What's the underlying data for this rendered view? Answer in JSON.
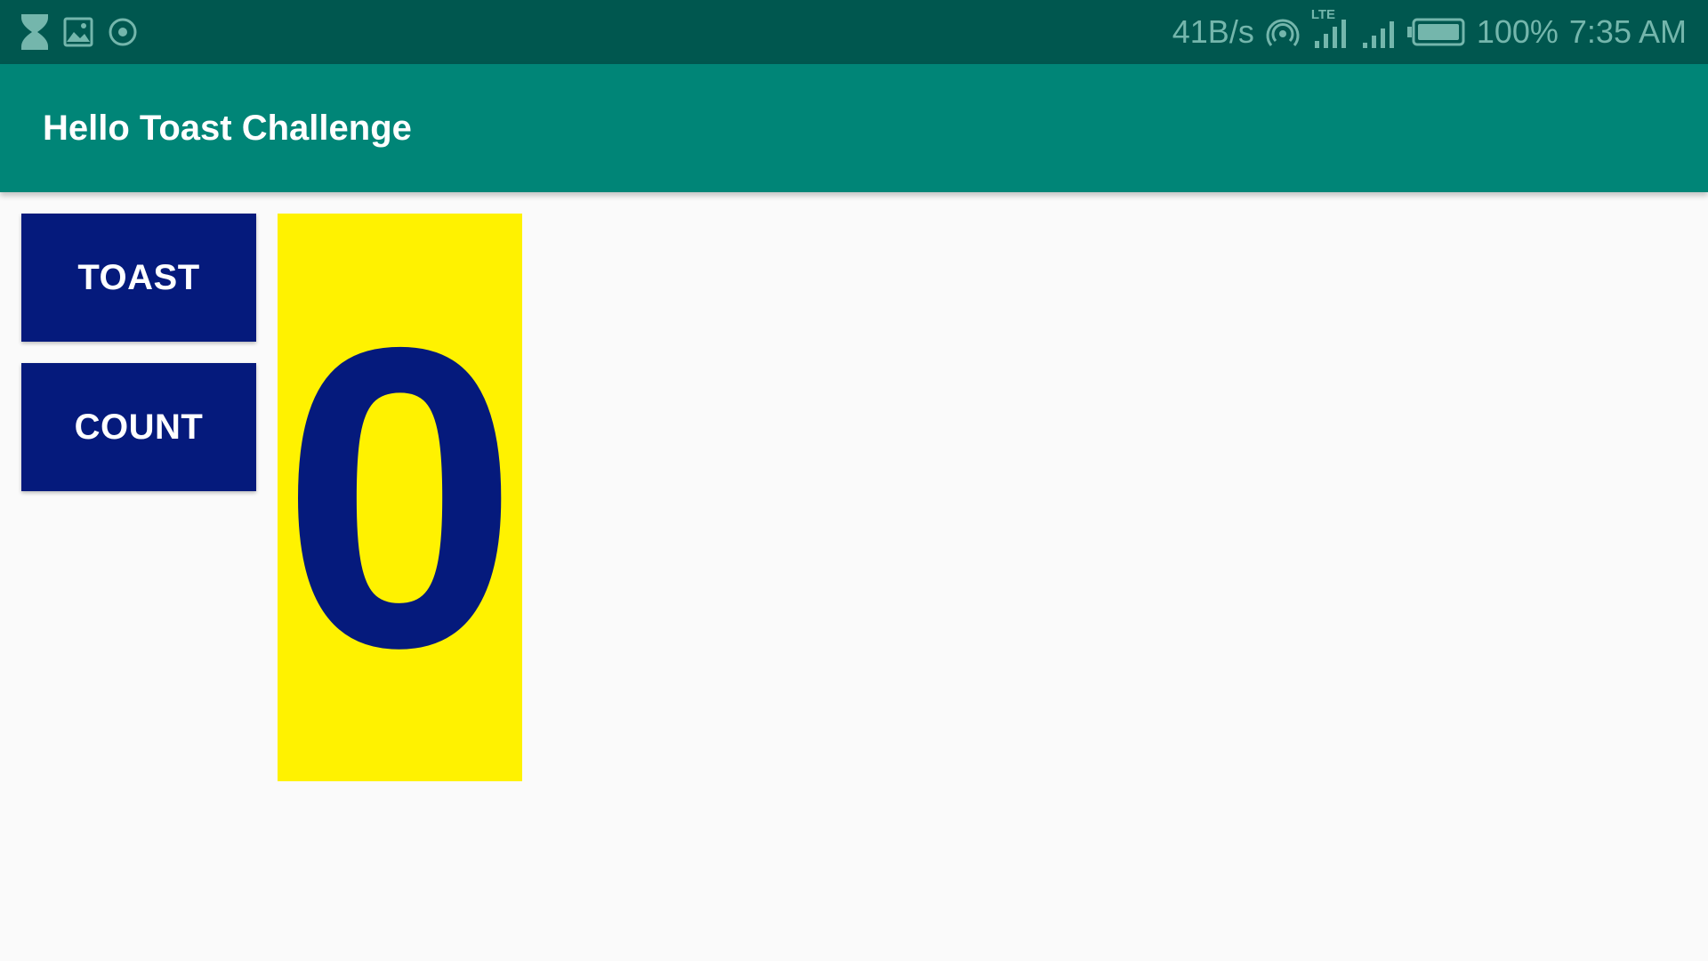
{
  "status_bar": {
    "left_icons": [
      "hourglass-icon",
      "image-icon",
      "record-icon"
    ],
    "net_speed": "41B/s",
    "network_type": "LTE",
    "battery": "100%",
    "time": "7:35 AM",
    "right_icons": [
      "hotspot-icon",
      "signal-lte-icon",
      "signal-icon",
      "battery-icon"
    ]
  },
  "app_bar": {
    "title": "Hello Toast Challenge"
  },
  "buttons": {
    "toast_label": "TOAST",
    "count_label": "COUNT"
  },
  "counter": {
    "value": "0"
  },
  "colors": {
    "status_bar": "#00574F",
    "app_bar": "#008577",
    "button_bg": "#051A7C",
    "button_text": "#FFFFFF",
    "counter_bg": "#FFF200",
    "counter_text": "#051A7C",
    "background": "#FAFAFA"
  }
}
